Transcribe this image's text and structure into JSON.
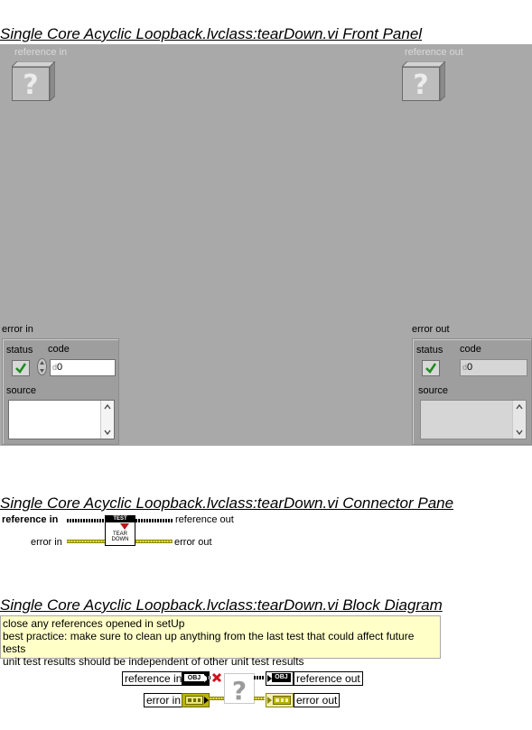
{
  "front_panel": {
    "title": "Single Core Acyclic Loopback.lvclass:tearDown.vi Front Panel",
    "reference_in_label": "reference in",
    "reference_out_label": "reference out",
    "error_in": {
      "label": "error in",
      "status_label": "status",
      "code_label": "code",
      "code_value": "0",
      "source_label": "source",
      "code_prefix": "d"
    },
    "error_out": {
      "label": "error out",
      "status_label": "status",
      "code_label": "code",
      "code_value": "0",
      "source_label": "source",
      "code_prefix": "d"
    }
  },
  "connector_pane": {
    "title": "Single Core Acyclic Loopback.lvclass:tearDown.vi Connector Pane",
    "reference_in": "reference in",
    "reference_out": "reference out",
    "error_in": "error in",
    "error_out": "error out",
    "icon_top": "TEST",
    "icon_line1": "TEAR",
    "icon_line2": "DOWN"
  },
  "block_diagram": {
    "title": "Single Core Acyclic Loopback.lvclass:tearDown.vi Block Diagram",
    "comment_lines": [
      "close any references opened in setUp",
      "best practice: make sure to clean up anything from the last test that could affect future tests",
      "unit test results should be independent of other unit test results"
    ],
    "reference_in": "reference in",
    "reference_out": "reference out",
    "error_in": "error in",
    "error_out": "error out",
    "obj_tag": "OBJ"
  },
  "colors": {
    "panel_bg": "#a9a9a9",
    "comment_bg": "#ffffc8",
    "error_wire": "#b9b400",
    "check_green": "#1e8c1e"
  }
}
